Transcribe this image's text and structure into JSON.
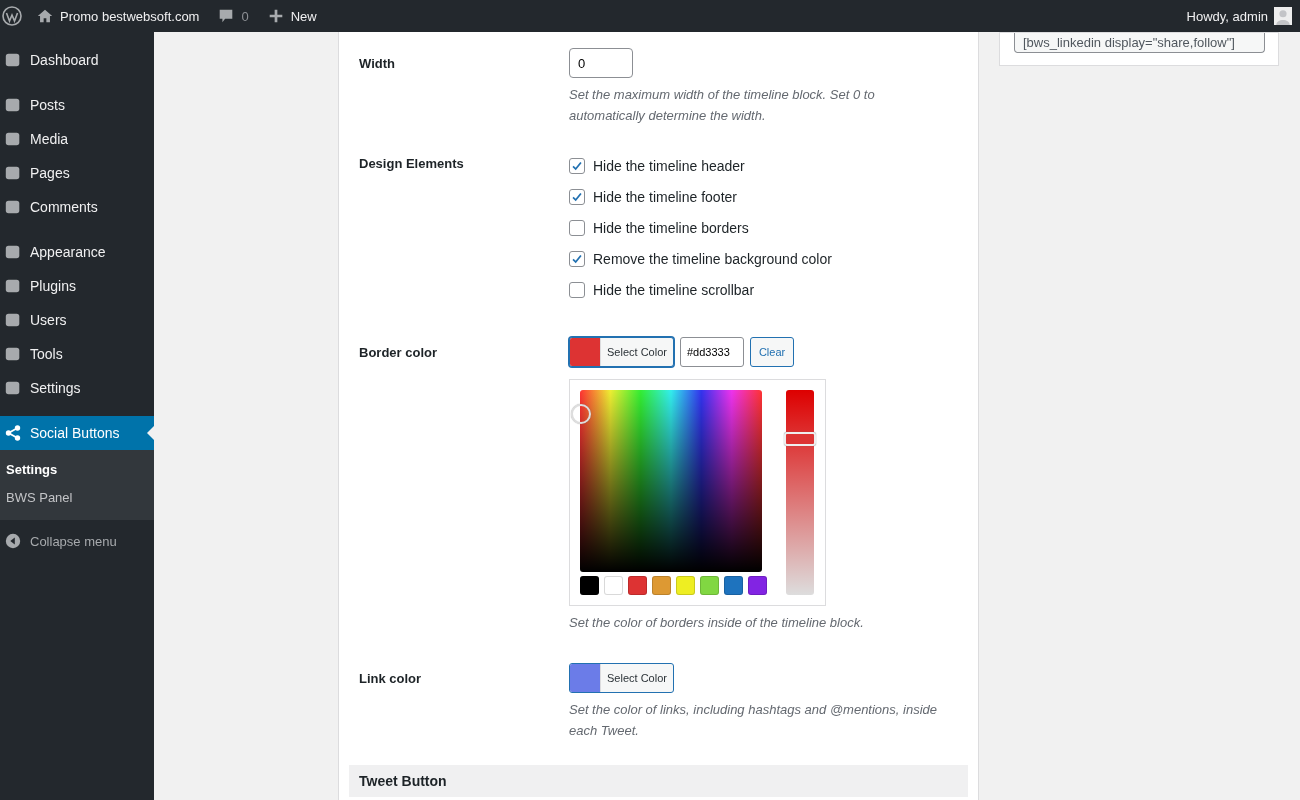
{
  "admin_bar": {
    "site": "Promo bestwebsoft.com",
    "comments": "0",
    "new": "New",
    "greeting": "Howdy, admin"
  },
  "menu_groups": [
    [
      {
        "label": "Dashboard",
        "selected": false
      }
    ],
    [
      {
        "label": "Posts",
        "selected": false
      },
      {
        "label": "Media",
        "selected": false
      },
      {
        "label": "Pages",
        "selected": false
      },
      {
        "label": "Comments",
        "selected": false
      }
    ],
    [
      {
        "label": "Appearance",
        "selected": false
      },
      {
        "label": "Plugins",
        "selected": false
      },
      {
        "label": "Users",
        "selected": false
      },
      {
        "label": "Tools",
        "selected": false
      },
      {
        "label": "Settings",
        "selected": false
      }
    ]
  ],
  "active_menu": {
    "label": "Social Buttons",
    "selected": true,
    "submenu": [
      {
        "label": "Settings",
        "selected": true
      },
      {
        "label": "BWS Panel",
        "selected": false
      }
    ]
  },
  "collapse": "Collapse menu",
  "width": {
    "label": "Width",
    "value": "0",
    "description": "Set the maximum width of the timeline block. Set 0 to automatically determine the width."
  },
  "design": {
    "label": "Design Elements",
    "options": [
      {
        "label": "Hide the timeline header",
        "checked": true
      },
      {
        "label": "Hide the timeline footer",
        "checked": true
      },
      {
        "label": "Hide the timeline borders",
        "checked": false
      },
      {
        "label": "Remove the timeline background color",
        "checked": true
      },
      {
        "label": "Hide the timeline scrollbar",
        "checked": false
      }
    ]
  },
  "border_color": {
    "label": "Border color",
    "color": "#dd3333",
    "button": "Select Color",
    "value": "#dd3333",
    "clear": "Clear",
    "picker_open": true,
    "level": 0.76,
    "palette": [
      {
        "color": "#000000"
      },
      {
        "color": "#ffffff"
      },
      {
        "color": "#dd3333"
      },
      {
        "color": "#dd9933"
      },
      {
        "color": "#eeee22"
      },
      {
        "color": "#81d742"
      },
      {
        "color": "#1e73be"
      },
      {
        "color": "#8224e3"
      }
    ],
    "description": "Set the color of borders inside of the timeline block."
  },
  "link_color": {
    "label": "Link color",
    "color": "#6b7ce8",
    "button": "Select Color",
    "description": "Set the color of links, including hashtags and @mentions, inside each Tweet."
  },
  "section": "Tweet Button",
  "shortcode": "[bws_linkedin display=\"share,follow\"]"
}
